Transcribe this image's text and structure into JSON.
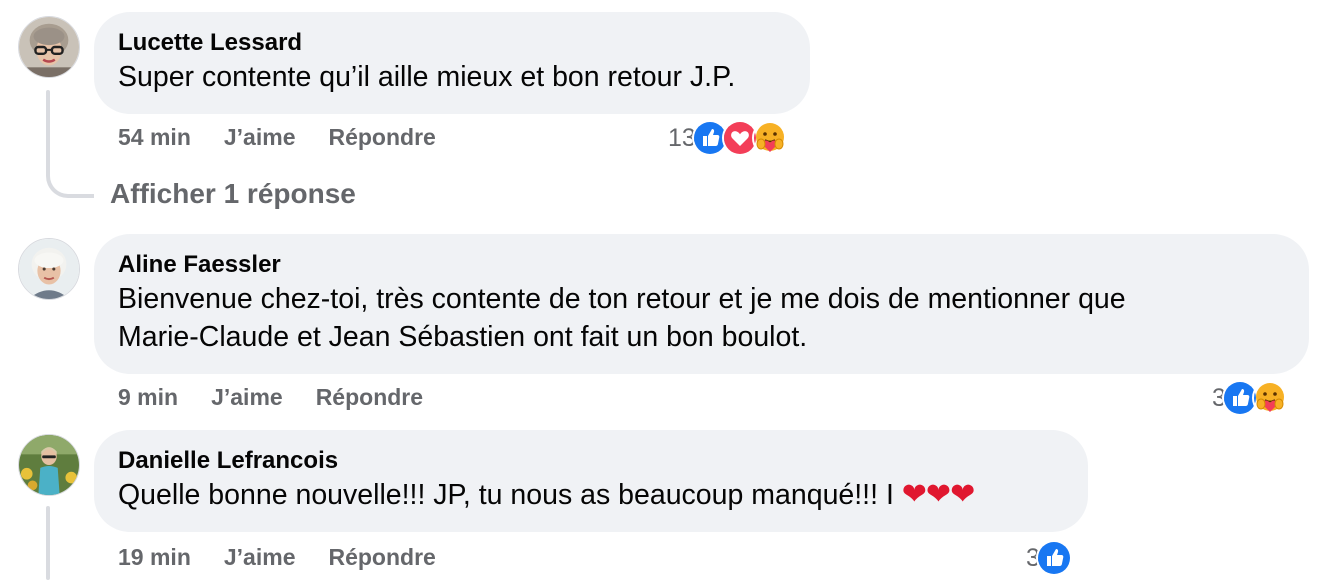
{
  "comments": [
    {
      "author": "Lucette Lessard",
      "text": "Super contente qu’il aille mieux et bon retour J.P.",
      "time": "54 min",
      "like_label": "J’aime",
      "reply_label": "Répondre",
      "reaction_count": "13",
      "reactions": [
        "like-icon",
        "love-icon",
        "care-icon"
      ]
    },
    {
      "author": "Aline Faessler",
      "text_line1": "Bienvenue chez-toi, très contente de ton retour et je me dois de mentionner que",
      "text_line2": "Marie-Claude et Jean Sébastien ont fait un bon boulot.",
      "time": "9 min",
      "like_label": "J’aime",
      "reply_label": "Répondre",
      "reaction_count": "3",
      "reactions": [
        "like-icon",
        "care-icon"
      ]
    },
    {
      "author": "Danielle Lefrancois",
      "text": "Quelle bonne nouvelle!!! JP, tu nous as beaucoup manqué!!! I",
      "hearts": "❤❤❤",
      "time": "19 min",
      "like_label": "J’aime",
      "reply_label": "Répondre",
      "reaction_count": "3",
      "reactions": [
        "like-icon"
      ]
    }
  ],
  "show_replies_label": "Afficher 1 réponse",
  "colors": {
    "bubble": "#f0f2f5",
    "meta": "#65676b",
    "like": "#1877f2",
    "love": "#f33e58",
    "thread_line": "#d9dbe0"
  }
}
